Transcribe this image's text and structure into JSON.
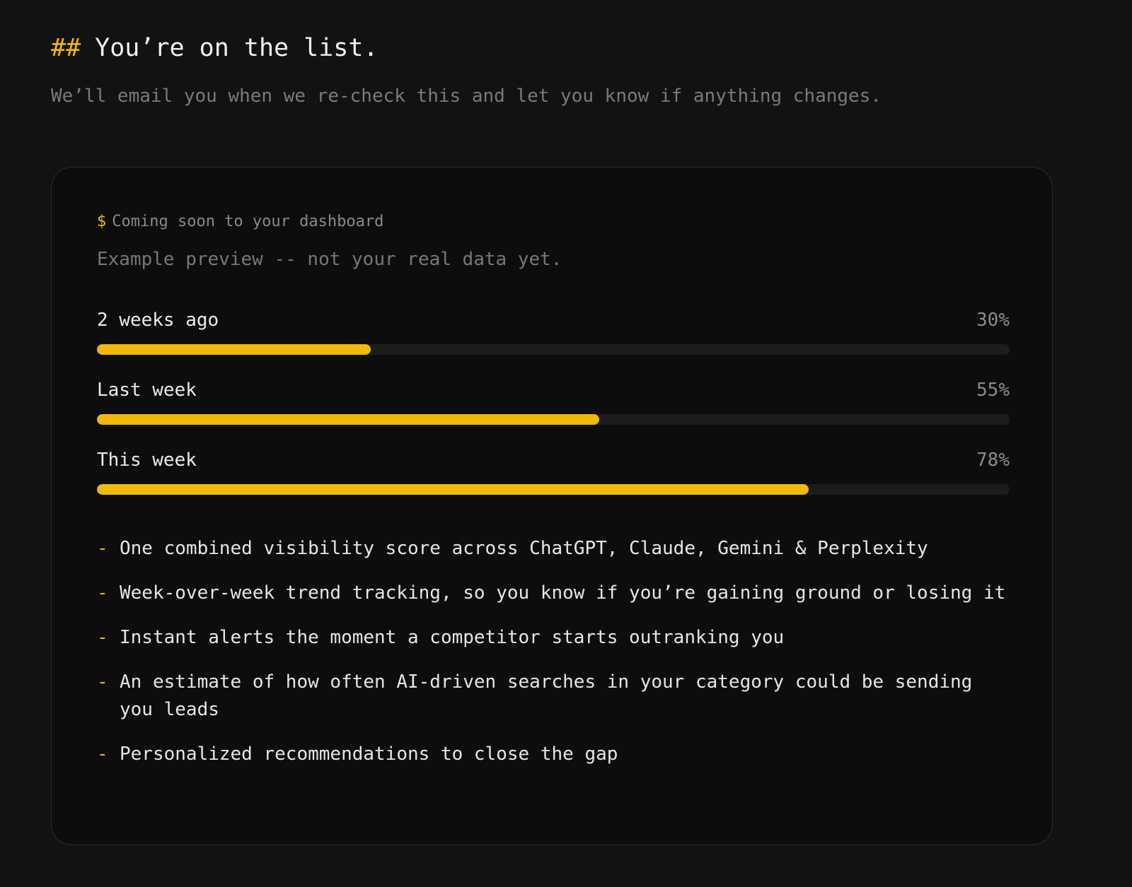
{
  "header": {
    "hash": "##",
    "title": "You’re on the list.",
    "subtitle": "We’ll email you when we re-check this and let you know if anything changes."
  },
  "card": {
    "prompt_symbol": "$",
    "prompt_text": "Coming soon to your dashboard",
    "preview_note": "Example preview -- not your real data yet.",
    "bars": [
      {
        "label": "2 weeks ago",
        "percent_label": "30%",
        "value": 30
      },
      {
        "label": "Last week",
        "percent_label": "55%",
        "value": 55
      },
      {
        "label": "This week",
        "percent_label": "78%",
        "value": 78
      }
    ],
    "bullet_symbol": "-",
    "features": [
      "One combined visibility score across ChatGPT, Claude, Gemini & Perplexity",
      "Week-over-week trend tracking, so you know if you’re gaining ground or losing it",
      "Instant alerts the moment a competitor starts outranking you",
      "An estimate of how often AI-driven searches in your category could be sending you leads",
      "Personalized recommendations to close the gap"
    ]
  },
  "colors": {
    "background": "#121212",
    "card_background": "#0d0d0d",
    "accent": "#f0b90b",
    "track": "#1c1c1c"
  }
}
